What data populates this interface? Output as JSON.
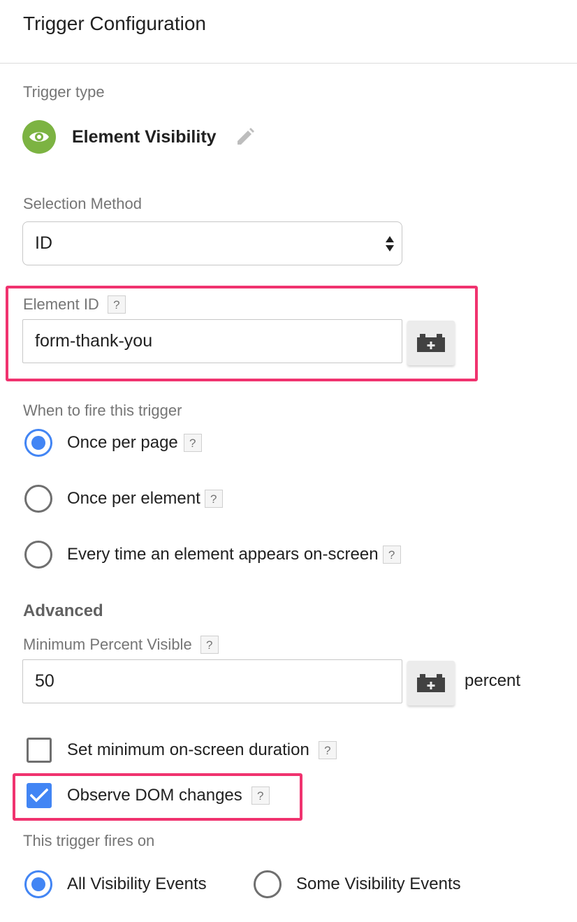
{
  "header": {
    "title": "Trigger Configuration"
  },
  "trigger_type": {
    "label": "Trigger type",
    "name": "Element Visibility",
    "icon": "eye-icon",
    "icon_color": "#7cb342"
  },
  "selection_method": {
    "label": "Selection Method",
    "value": "ID"
  },
  "element_id": {
    "label": "Element ID",
    "help": "?",
    "value": "form-thank-you"
  },
  "fire_when": {
    "label": "When to fire this trigger",
    "options": [
      {
        "label": "Once per page",
        "help": "?",
        "selected": true
      },
      {
        "label": "Once per element",
        "help": "?",
        "selected": false
      },
      {
        "label": "Every time an element appears on-screen",
        "help": "?",
        "selected": false
      }
    ]
  },
  "advanced": {
    "heading": "Advanced",
    "min_percent": {
      "label": "Minimum Percent Visible",
      "help": "?",
      "value": "50",
      "unit": "percent"
    },
    "min_duration": {
      "label": "Set minimum on-screen duration",
      "help": "?",
      "checked": false
    },
    "observe_dom": {
      "label": "Observe DOM changes",
      "help": "?",
      "checked": true
    }
  },
  "fires_on": {
    "label": "This trigger fires on",
    "options": [
      {
        "label": "All Visibility Events",
        "selected": true
      },
      {
        "label": "Some Visibility Events",
        "selected": false
      }
    ]
  },
  "colors": {
    "accent": "#4285f4",
    "highlight": "#f0336f"
  }
}
